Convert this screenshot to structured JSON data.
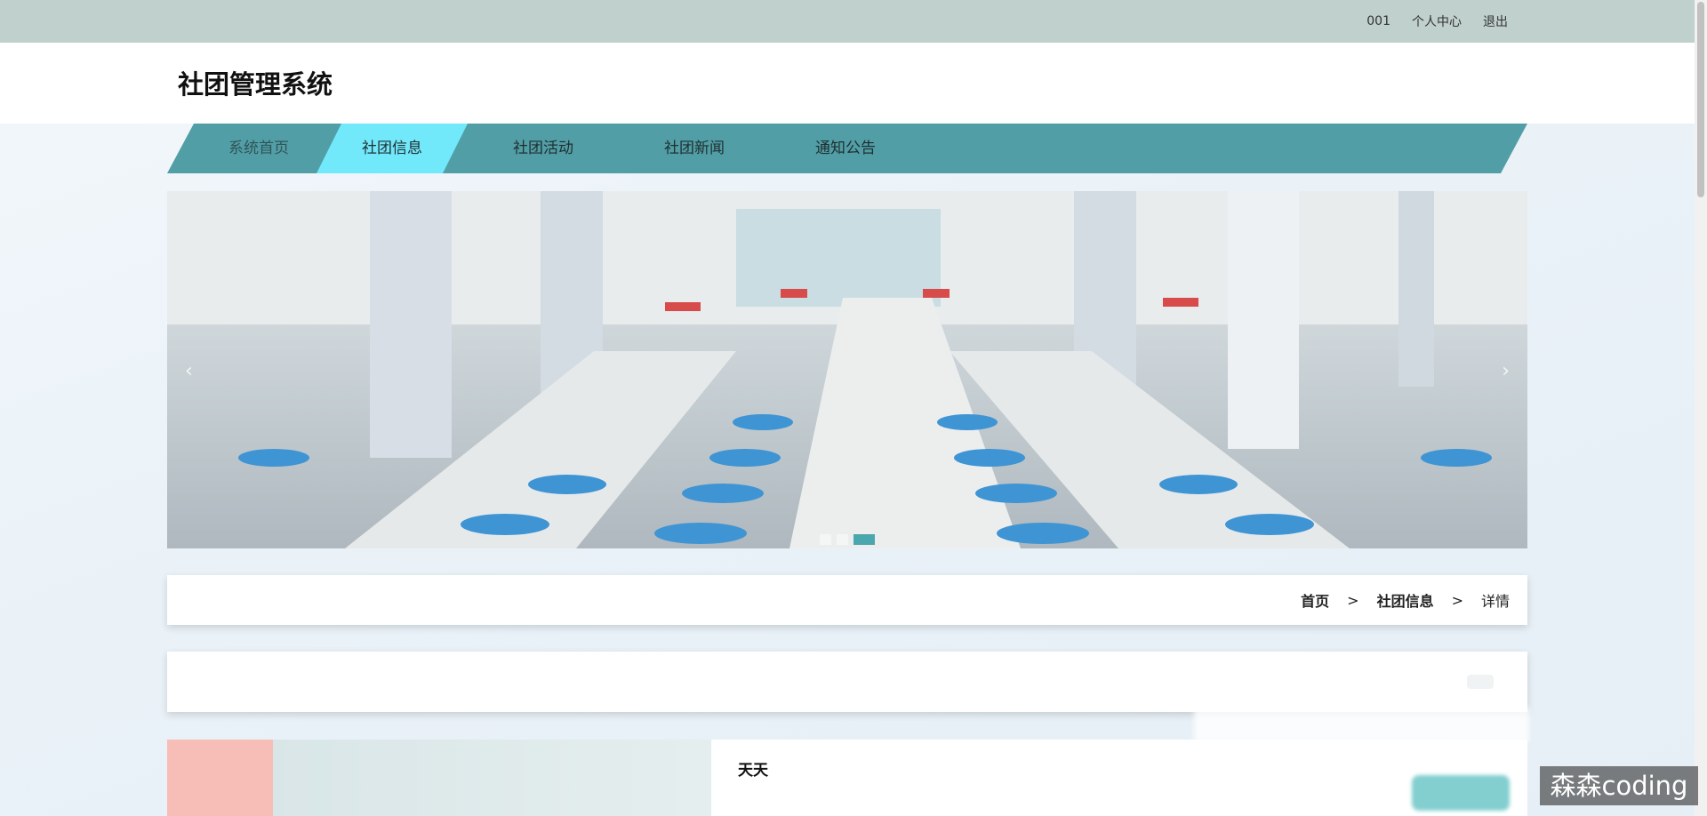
{
  "topbar": {
    "user": "001",
    "profile": "个人中心",
    "logout": "退出"
  },
  "header": {
    "title": "社团管理系统"
  },
  "nav": {
    "items": [
      "系统首页",
      "社团信息",
      "社团活动",
      "社团新闻",
      "通知公告"
    ],
    "active_index": 1
  },
  "banner": {
    "prev": "‹",
    "next": "›",
    "slide_count": 3,
    "active_slide": 3
  },
  "breadcrumb": {
    "home": "首页",
    "sep": ">",
    "section": "社团信息",
    "current": "详情"
  },
  "card": {
    "name": "天天"
  },
  "watermark": "森森coding",
  "colors": {
    "topbar": "#bfd0cd",
    "nav": "#519ea6",
    "nav_active": "#72e8fb",
    "accent": "#4aa7ad"
  }
}
